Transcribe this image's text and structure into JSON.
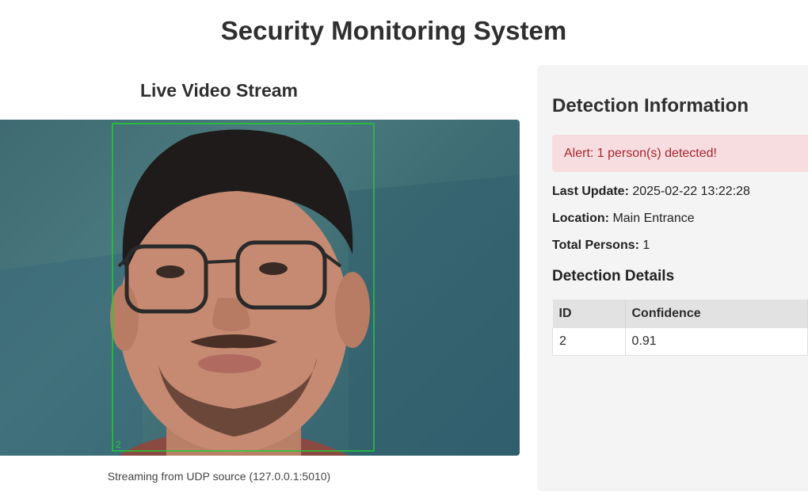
{
  "header": {
    "title": "Security Monitoring System"
  },
  "video": {
    "heading": "Live Video Stream",
    "caption": "Streaming from UDP source (127.0.0.1:5010)",
    "detection_box_label": "2",
    "box_color": "#22cc33"
  },
  "info": {
    "heading": "Detection Information",
    "alert": "Alert: 1 person(s) detected!",
    "last_update_label": "Last Update:",
    "last_update_value": "2025-02-22 13:22:28",
    "location_label": "Location:",
    "location_value": "Main Entrance",
    "total_label": "Total Persons:",
    "total_value": "1",
    "details_heading": "Detection Details",
    "table": {
      "headers": [
        "ID",
        "Confidence"
      ],
      "rows": [
        [
          "2",
          "0.91"
        ]
      ]
    }
  },
  "colors": {
    "alert_bg": "#f8dde0",
    "alert_text": "#a5262d",
    "panel_bg": "#f4f4f4"
  }
}
